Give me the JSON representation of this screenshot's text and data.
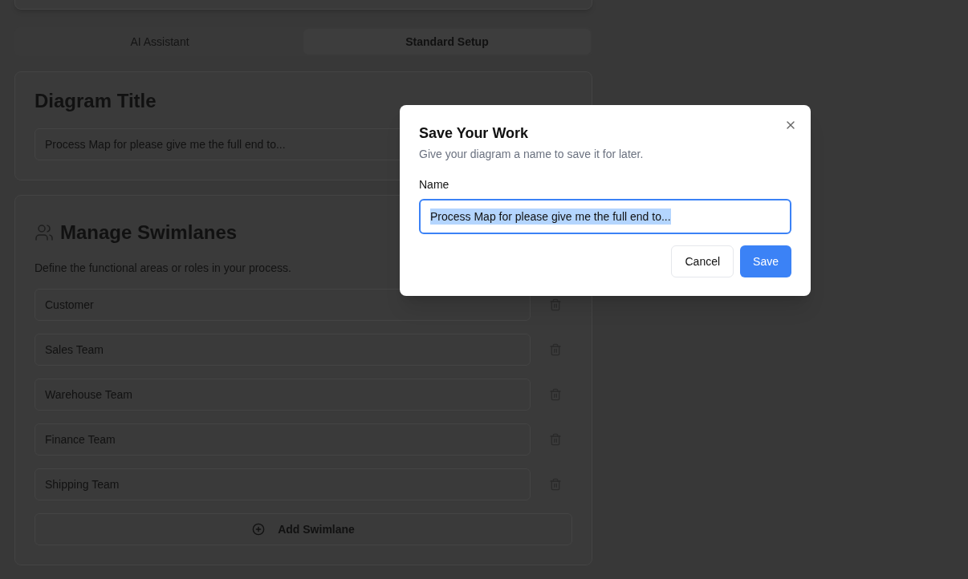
{
  "tabs": [
    {
      "label": "AI Assistant",
      "selected": false
    },
    {
      "label": "Standard Setup",
      "selected": true
    }
  ],
  "diagram_title": {
    "heading": "Diagram Title",
    "value": "Process Map for please give me the full end to..."
  },
  "swimlanes": {
    "heading": "Manage Swimlanes",
    "description": "Define the functional areas or roles in your process.",
    "lanes": [
      "Customer",
      "Sales Team",
      "Warehouse Team",
      "Finance Team",
      "Shipping Team"
    ],
    "add_button": "Add Swimlane"
  },
  "dialog": {
    "title": "Save Your Work",
    "description": "Give your diagram a name to save it for later.",
    "field_label": "Name",
    "value": "Process Map for please give me the full end to...",
    "value_selected": true,
    "focused": true,
    "buttons": [
      {
        "label": "Cancel",
        "kind": "secondary"
      },
      {
        "label": "Save",
        "kind": "primary"
      }
    ]
  }
}
